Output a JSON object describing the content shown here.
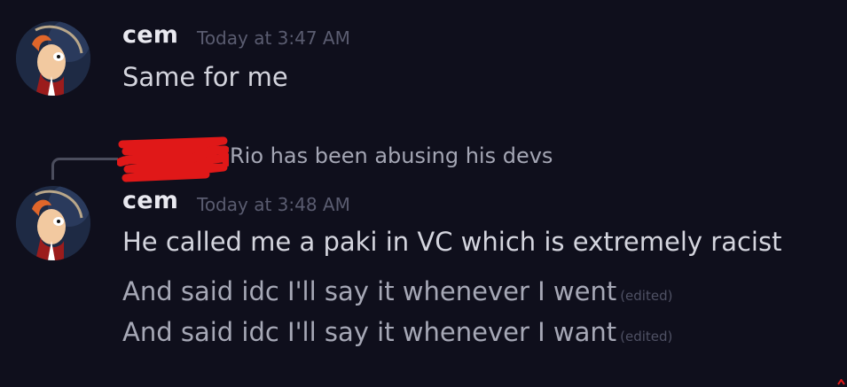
{
  "messages": [
    {
      "author": "cem",
      "timestamp": "Today at 3:47 AM",
      "lines": [
        "Same for me"
      ]
    },
    {
      "author": "cem",
      "timestamp": "Today at 3:48 AM",
      "reply": {
        "text": "Rio has been abusing his devs"
      },
      "lines": [
        "He called me a paki in VC which is extremely racist",
        "And said idc I'll say it whenever I went",
        "And said idc I'll say it whenever I want"
      ],
      "edited_label": "(edited)"
    }
  ],
  "icons": {
    "avatar": "avatar-cartoon-icon",
    "redaction": "red-scribble-redaction"
  },
  "colors": {
    "background": "#0f0f1c",
    "username": "#e9e9f0",
    "timestamp": "#5a5c70",
    "message": "#d4d5de",
    "redaction": "#e01818"
  }
}
